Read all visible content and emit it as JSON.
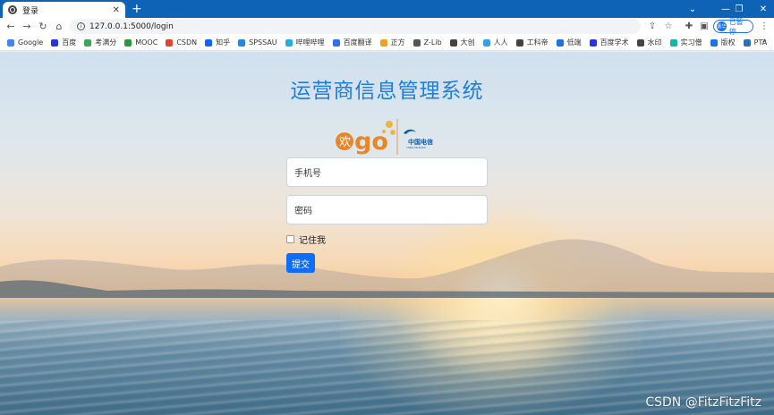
{
  "browser": {
    "tab_title": "登录",
    "tab_close": "✕",
    "new_tab": "+",
    "url": "127.0.0.1:5000/login",
    "profile_avatar": "嘉华",
    "profile_label": "已暂停",
    "bookmarks": [
      {
        "label": "Google",
        "color": "#4285f4"
      },
      {
        "label": "百度",
        "color": "#2932e1"
      },
      {
        "label": "考满分",
        "color": "#3aa757"
      },
      {
        "label": "MOOC",
        "color": "#2b9939"
      },
      {
        "label": "CSDN",
        "color": "#e0472b"
      },
      {
        "label": "知乎",
        "color": "#0a66ff"
      },
      {
        "label": "SPSSAU",
        "color": "#1e88e5"
      },
      {
        "label": "哔哩哔哩",
        "color": "#23ade5"
      },
      {
        "label": "百度翻译",
        "color": "#2f6ee8"
      },
      {
        "label": "正方",
        "color": "#f0a020"
      },
      {
        "label": "Z-Lib",
        "color": "#555555"
      },
      {
        "label": "大创",
        "color": "#444444"
      },
      {
        "label": "人人",
        "color": "#2fa4e7"
      },
      {
        "label": "工科帝",
        "color": "#444444"
      },
      {
        "label": "低端",
        "color": "#1a73e8"
      },
      {
        "label": "百度学术",
        "color": "#2932e1"
      },
      {
        "label": "水印",
        "color": "#444444"
      },
      {
        "label": "实习僧",
        "color": "#13b5a6"
      },
      {
        "label": "版权",
        "color": "#1a73e8"
      },
      {
        "label": "PTA",
        "color": "#2a6fb8"
      }
    ],
    "bookmarks_more": "»"
  },
  "page": {
    "title": "运营商信息管理系统",
    "logo_text": "欢go",
    "logo_brand": "中国电信",
    "logo_brand_en": "CHINA TELECOM",
    "phone_placeholder": "手机号",
    "password_placeholder": "密码",
    "remember_label": "记住我",
    "submit_label": "提交",
    "watermark": "CSDN @FitzFitzFitz"
  },
  "colors": {
    "tabstrip": "#0f63b6",
    "title": "#1e7ee0",
    "submit": "#0d6efd",
    "logo_orange": "#e8872a",
    "telecom_blue": "#0a5fb4"
  }
}
